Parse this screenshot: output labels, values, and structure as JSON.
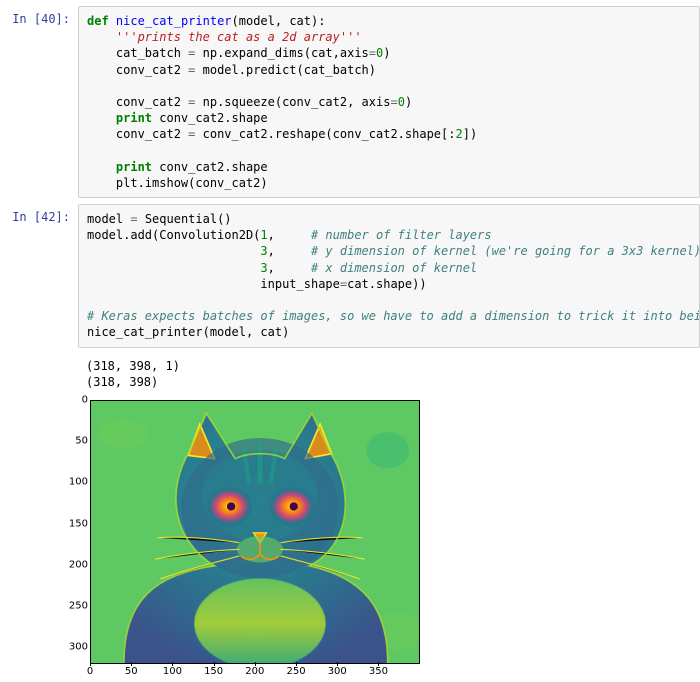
{
  "cells": [
    {
      "prompt": "In [40]:",
      "tokens": [
        [
          [
            "kw",
            "def"
          ],
          [
            "nm",
            " "
          ],
          [
            "nf",
            "nice_cat_printer"
          ],
          [
            "nm",
            "(model, cat):"
          ]
        ],
        [
          [
            "nm",
            "    "
          ],
          [
            "doc",
            "'''prints the cat as a 2d array'''"
          ]
        ],
        [
          [
            "nm",
            "    cat_batch "
          ],
          [
            "op",
            "="
          ],
          [
            "nm",
            " np.expand_dims(cat,axis"
          ],
          [
            "op",
            "="
          ],
          [
            "num",
            "0"
          ],
          [
            "nm",
            ")"
          ]
        ],
        [
          [
            "nm",
            "    conv_cat2 "
          ],
          [
            "op",
            "="
          ],
          [
            "nm",
            " model.predict(cat_batch)"
          ]
        ],
        [
          [
            "nm",
            " "
          ]
        ],
        [
          [
            "nm",
            "    conv_cat2 "
          ],
          [
            "op",
            "="
          ],
          [
            "nm",
            " np.squeeze(conv_cat2, axis"
          ],
          [
            "op",
            "="
          ],
          [
            "num",
            "0"
          ],
          [
            "nm",
            ")"
          ]
        ],
        [
          [
            "nm",
            "    "
          ],
          [
            "kw",
            "print"
          ],
          [
            "nm",
            " conv_cat2.shape"
          ]
        ],
        [
          [
            "nm",
            "    conv_cat2 "
          ],
          [
            "op",
            "="
          ],
          [
            "nm",
            " conv_cat2.reshape(conv_cat2.shape[:"
          ],
          [
            "num",
            "2"
          ],
          [
            "nm",
            "])"
          ]
        ],
        [
          [
            "nm",
            " "
          ]
        ],
        [
          [
            "nm",
            "    "
          ],
          [
            "kw",
            "print"
          ],
          [
            "nm",
            " conv_cat2.shape"
          ]
        ],
        [
          [
            "nm",
            "    plt.imshow(conv_cat2)"
          ]
        ]
      ]
    },
    {
      "prompt": "In [42]:",
      "tokens": [
        [
          [
            "nm",
            "model "
          ],
          [
            "op",
            "="
          ],
          [
            "nm",
            " Sequential()"
          ]
        ],
        [
          [
            "nm",
            "model.add(Convolution2D("
          ],
          [
            "num",
            "1"
          ],
          [
            "nm",
            ",     "
          ],
          [
            "cmt",
            "# number of filter layers"
          ]
        ],
        [
          [
            "nm",
            "                        "
          ],
          [
            "num",
            "3"
          ],
          [
            "nm",
            ",     "
          ],
          [
            "cmt",
            "# y dimension of kernel (we're going for a 3x3 kernel)"
          ]
        ],
        [
          [
            "nm",
            "                        "
          ],
          [
            "num",
            "3"
          ],
          [
            "nm",
            ",     "
          ],
          [
            "cmt",
            "# x dimension of kernel"
          ]
        ],
        [
          [
            "nm",
            "                        input_shape"
          ],
          [
            "op",
            "="
          ],
          [
            "nm",
            "cat.shape))"
          ]
        ],
        [
          [
            "nm",
            " "
          ]
        ],
        [
          [
            "cmt",
            "# Keras expects batches of images, so we have to add a dimension to trick it into being nice"
          ]
        ],
        [
          [
            "nm",
            "nice_cat_printer(model, cat)"
          ]
        ]
      ]
    }
  ],
  "stdout": {
    "line1": "(318, 398, 1)",
    "line2": "(318, 398)"
  },
  "chart_data": {
    "type": "heatmap",
    "xlim": [
      0,
      398
    ],
    "ylim": [
      318,
      0
    ],
    "x_ticks": [
      0,
      50,
      100,
      150,
      200,
      250,
      300,
      350
    ],
    "y_ticks": [
      0,
      50,
      100,
      150,
      200,
      250,
      300
    ],
    "colormap": "viridis",
    "description": "imshow output of a 318x398 convolved cat image; background mostly mid-green, cat body blue/cyan with yellow-orange highlights around eyes, nose, ear edges and whiskers."
  }
}
